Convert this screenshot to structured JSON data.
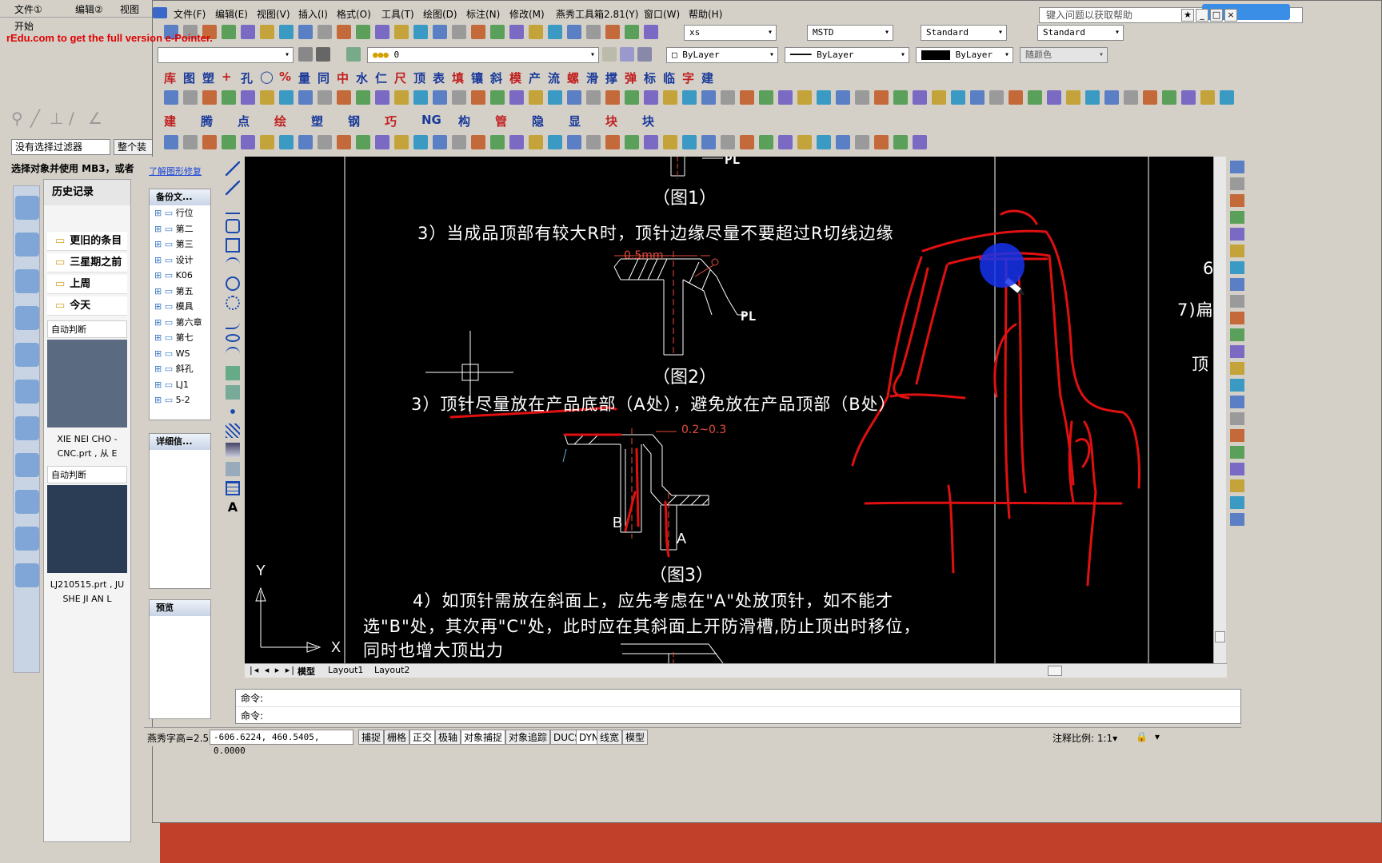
{
  "bg_window": {
    "menu": [
      "文件①",
      "编辑②",
      "视图"
    ],
    "start_label": "开始",
    "watermark": "rEdu.com to get the full version e-Pointer.",
    "filter_select": "没有选择过滤器",
    "filter_select2": "整个装",
    "hint": "选择对象并使用 MB3，或者",
    "history_title": "历史记录",
    "folders": [
      "更旧的条目",
      "三星期之前",
      "上周",
      "今天"
    ],
    "auto_label": "自动判断",
    "items": [
      {
        "caption": "XIE NEI CHO -CNC.prt , 从 E"
      },
      {
        "caption": "LJ210515.prt , JU SHE JI AN L"
      }
    ]
  },
  "cad": {
    "menu": [
      "文件(F)",
      "编辑(E)",
      "视图(V)",
      "插入(I)",
      "格式(O)",
      "工具(T)",
      "绘图(D)",
      "标注(N)",
      "修改(M)",
      "燕秀工具箱2.81(Y)",
      "窗口(W)",
      "帮助(H)"
    ],
    "help_placeholder": "键入问题以获取帮助",
    "text_style": "xs",
    "dim_style": "MSTD",
    "table_style": "Standard",
    "multileader_style": "Standard",
    "layer_value": "0",
    "color_value": "ByLayer",
    "linetype_value": "ByLayer",
    "lineweight_value": "ByLayer",
    "plotstyle_value": "随颜色",
    "cn_tools_row1": [
      "库",
      "图",
      "塑",
      "+",
      "孔",
      "◯",
      "%",
      "量",
      "同",
      "中",
      "水",
      "仁",
      "尺",
      "顶",
      "表",
      "填",
      "镶",
      "斜",
      "模",
      "产",
      "流",
      "螺",
      "滑",
      "撑",
      "弹",
      "标",
      "临",
      "字",
      "建"
    ],
    "cn_tools_row3": [
      "建",
      "腾",
      "点",
      "绘",
      "塑",
      "钢",
      "巧",
      "NG",
      "构",
      "管",
      "隐",
      "显",
      "块",
      "块"
    ],
    "side_panel": {
      "link": "了解图形修复",
      "files_header": "备份文...",
      "nodes": [
        "行位",
        "第二",
        "第三",
        "设计",
        "K06",
        "第五",
        "模具",
        "第六章",
        "第七",
        "WS",
        "斜孔",
        "LJ1",
        "5-2"
      ],
      "details_header": "详细信...",
      "preview_header": "预览"
    },
    "canvas": {
      "texts": {
        "pl_top": "PL",
        "fig1": "（图1）",
        "line3a": "3）当成品顶部有较大R时，顶针边缘尽量不要超过R切线边缘",
        "dim05": "0.5mm",
        "pl_mid": "PL",
        "fig2": "（图2）",
        "line3b": "3）顶针尽量放在产品底部（A处），避免放在产品顶部（B处）",
        "dim02": "0.2~0.3",
        "label_b": "B",
        "label_a": "A",
        "fig3": "（图3）",
        "line4a": "4）如顶针需放在斜面上，应先考虑在\"A\"处放顶针，如不能才",
        "line4b": "选\"B\"处，其次再\"C\"处，此时应在其斜面上开防滑槽,防止顶出时移位，",
        "line4c": "同时也增大顶出力",
        "axis_y": "Y",
        "axis_x": "X",
        "right_6": "6",
        "right_7": "7)扁",
        "right_ding": "顶"
      }
    },
    "layout_tabs": [
      "模型",
      "Layout1",
      "Layout2"
    ],
    "cmd_lines": [
      "命令:",
      "命令:"
    ],
    "status": {
      "text_height": "燕秀字高=2.5",
      "coords": "-606.6224, 460.5405, 0.0000",
      "toggles": [
        "捕捉",
        "栅格",
        "正交",
        "极轴",
        "对象捕捉",
        "对象追踪",
        "DUCS",
        "DYN",
        "线宽",
        "模型"
      ],
      "scale_label": "注释比例: 1:1▾"
    }
  },
  "colors": {
    "canvas_bg": "#000000",
    "annotation_red": "#e11010",
    "dim_red": "#e74c3c",
    "pointer_blue": "#1733ee",
    "ui_gray": "#d4d0c8"
  }
}
